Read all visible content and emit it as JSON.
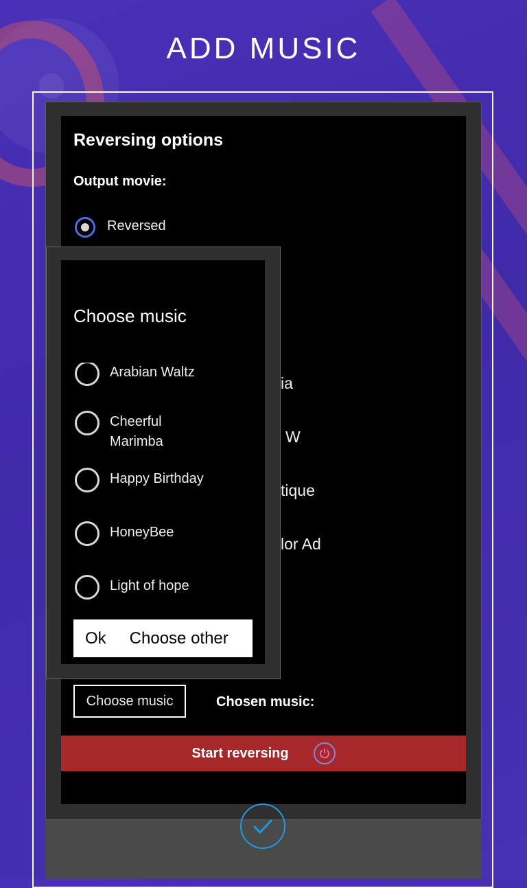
{
  "page": {
    "title": "ADD MUSIC"
  },
  "options": {
    "heading": "Reversing options",
    "output_label": "Output movie:",
    "reversed_label": "Reversed",
    "partial_texts": [
      "ia",
      "W",
      "tique",
      "lor Ad"
    ]
  },
  "dialog": {
    "title": "Choose music",
    "items": [
      {
        "label": "Arabian Waltz"
      },
      {
        "label": "Cheerful Marimba"
      },
      {
        "label": "Happy Birthday"
      },
      {
        "label": "HoneyBee"
      },
      {
        "label": "Light of hope"
      }
    ],
    "ok_label": "Ok",
    "choose_other_label": "Choose other"
  },
  "footer": {
    "choose_music_label": "Choose music",
    "chosen_music_label": "Chosen music:",
    "start_label": "Start reversing"
  },
  "colors": {
    "accent_radio": "#4f6be0",
    "start_bar": "#a6282b",
    "check_circle": "#1e9be0"
  },
  "icons": [
    "power-icon",
    "checkmark-icon",
    "film-reel-icon"
  ]
}
